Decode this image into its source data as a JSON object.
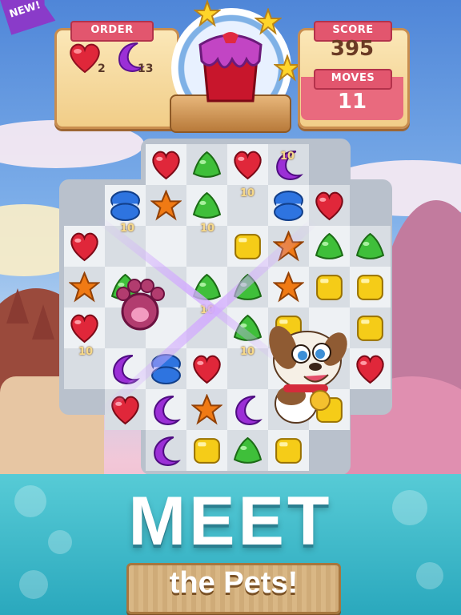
{
  "badge": {
    "text": "NEW!"
  },
  "hud": {
    "order_label": "ORDER",
    "order_items": [
      {
        "icon": "red-heart-candy",
        "count": "2"
      },
      {
        "icon": "purple-moon-candy",
        "count": "13"
      }
    ],
    "score_label": "SCORE",
    "score_value": "395",
    "moves_label": "MOVES",
    "moves_value": "11"
  },
  "board": {
    "floating_points": [
      "10",
      "10",
      "10",
      "10",
      "10",
      "10",
      "10"
    ]
  },
  "banner": {
    "headline": "MEET",
    "subline": "the Pets!"
  },
  "colors": {
    "heart": "#e0273a",
    "moon": "#9b2fd6",
    "macaron": "#2e74e0",
    "star": "#f07a14",
    "gumdrop": "#3fbf3a",
    "cube": "#f5cc18",
    "ribbon": "#e2566e",
    "banner_teal": "#3db8c9"
  }
}
